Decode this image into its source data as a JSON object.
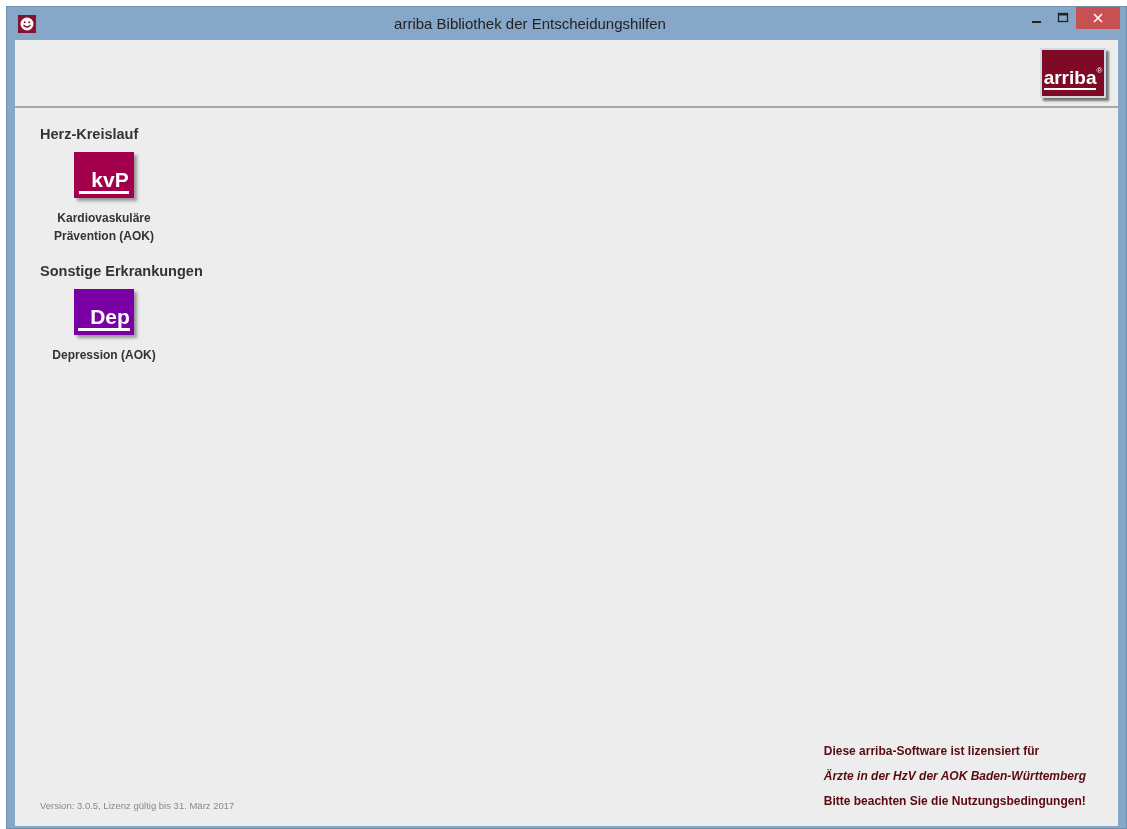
{
  "window": {
    "title": "arriba Bibliothek der Entscheidungshilfen"
  },
  "toolbar": {
    "logo": {
      "text": "arriba",
      "mark": "®"
    }
  },
  "categories": [
    {
      "title": "Herz-Kreislauf",
      "apps": [
        {
          "abbreviation": "kvP",
          "label": "Kardiovaskuläre Prävention (AOK)",
          "color": "#a3004c"
        }
      ]
    },
    {
      "title": "Sonstige Erkrankungen",
      "apps": [
        {
          "abbreviation": "Dep",
          "label": "Depression (AOK)",
          "color": "#7a00a6"
        }
      ]
    }
  ],
  "footer": {
    "version": "Version: 3.0.5, Lizenz gültig bis 31. März 2017",
    "license": [
      {
        "kind": "plain",
        "text": "Diese arriba-Software ist lizensiert für"
      },
      {
        "kind": "italic",
        "text": "Ärzte in der HzV der AOK Baden-Württemberg"
      },
      {
        "kind": "plain",
        "text": "Bitte beachten Sie die Nutzungsbedingungen!"
      }
    ]
  }
}
